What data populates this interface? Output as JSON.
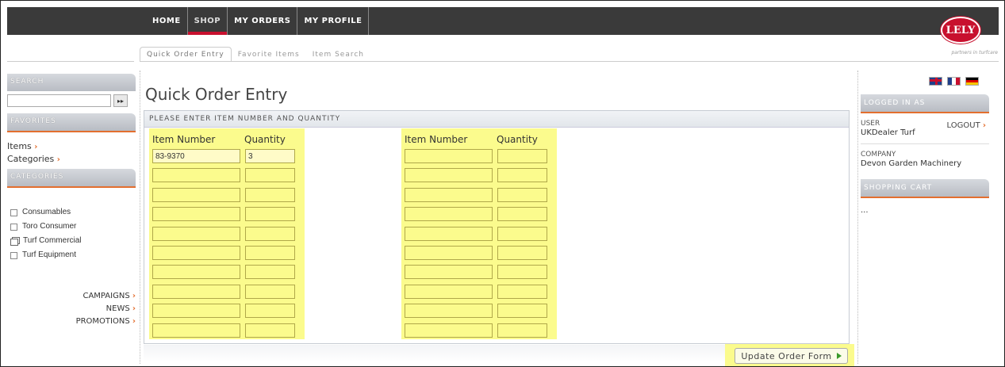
{
  "topnav": {
    "items": [
      {
        "label": "HOME"
      },
      {
        "label": "SHOP",
        "active": true
      },
      {
        "label": "MY ORDERS"
      },
      {
        "label": "MY PROFILE"
      }
    ]
  },
  "brand": {
    "logo_text": "LELY",
    "tagline": "partners in turfcare",
    "accent_color": "#c8102e",
    "highlight_color": "#fbfb8d",
    "link_arrow_color": "#e36f2f"
  },
  "subnav": {
    "items": [
      {
        "label": "Quick Order Entry",
        "active": true
      },
      {
        "label": "Favorite Items"
      },
      {
        "label": "Item Search"
      }
    ]
  },
  "sidebar": {
    "search_header": "SEARCH",
    "search_value": "",
    "search_button": "▸▸",
    "favorites_header": "FAVORITES",
    "favorites": [
      {
        "label": "Items"
      },
      {
        "label": "Categories"
      }
    ],
    "categories_header": "CATEGORIES",
    "categories": [
      {
        "label": "Consumables",
        "icon": "checkbox-icon"
      },
      {
        "label": "Toro Consumer",
        "icon": "checkbox-icon"
      },
      {
        "label": "Turf Commercial",
        "icon": "folder-stack-icon"
      },
      {
        "label": "Turf Equipment",
        "icon": "checkbox-icon"
      }
    ],
    "bottom_links": [
      {
        "label": "CAMPAIGNS"
      },
      {
        "label": "NEWS"
      },
      {
        "label": "PROMOTIONS"
      }
    ],
    "arrow": "›"
  },
  "main": {
    "title": "Quick Order Entry",
    "panel_header": "PLEASE ENTER ITEM NUMBER AND QUANTITY",
    "columns": [
      {
        "item_header": "Item Number",
        "qty_header": "Quantity",
        "rows": [
          {
            "item": "83-9370",
            "qty": "3"
          },
          {
            "item": "",
            "qty": ""
          },
          {
            "item": "",
            "qty": ""
          },
          {
            "item": "",
            "qty": ""
          },
          {
            "item": "",
            "qty": ""
          },
          {
            "item": "",
            "qty": ""
          },
          {
            "item": "",
            "qty": ""
          },
          {
            "item": "",
            "qty": ""
          },
          {
            "item": "",
            "qty": ""
          },
          {
            "item": "",
            "qty": ""
          }
        ]
      },
      {
        "item_header": "Item Number",
        "qty_header": "Quantity",
        "rows": [
          {
            "item": "",
            "qty": ""
          },
          {
            "item": "",
            "qty": ""
          },
          {
            "item": "",
            "qty": ""
          },
          {
            "item": "",
            "qty": ""
          },
          {
            "item": "",
            "qty": ""
          },
          {
            "item": "",
            "qty": ""
          },
          {
            "item": "",
            "qty": ""
          },
          {
            "item": "",
            "qty": ""
          },
          {
            "item": "",
            "qty": ""
          },
          {
            "item": "",
            "qty": ""
          }
        ]
      }
    ],
    "update_button": "Update Order Form"
  },
  "right": {
    "flags": [
      "uk-flag-icon",
      "france-flag-icon",
      "germany-flag-icon"
    ],
    "logged_in_header": "LOGGED IN AS",
    "user_label": "USER",
    "user_value": "UKDealer Turf",
    "logout_label": "LOGOUT",
    "company_label": "COMPANY",
    "company_value": "Devon Garden Machinery",
    "cart_header": "SHOPPING CART",
    "cart_value": "..."
  }
}
